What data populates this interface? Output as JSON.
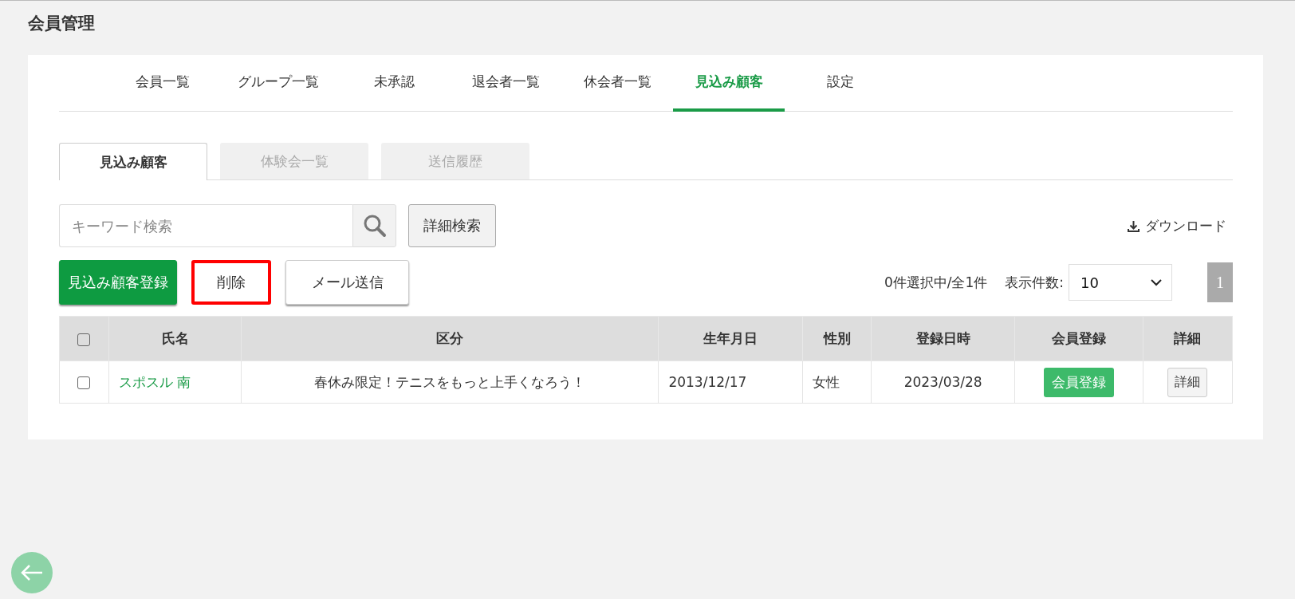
{
  "page_title": "会員管理",
  "tabs": [
    {
      "label": "会員一覧",
      "selected": false
    },
    {
      "label": "グループ一覧",
      "selected": false
    },
    {
      "label": "未承認",
      "selected": false
    },
    {
      "label": "退会者一覧",
      "selected": false
    },
    {
      "label": "休会者一覧",
      "selected": false
    },
    {
      "label": "見込み顧客",
      "selected": true
    },
    {
      "label": "設定",
      "selected": false
    }
  ],
  "sub_tabs": [
    {
      "label": "見込み顧客",
      "selected": true
    },
    {
      "label": "体験会一覧",
      "selected": false
    },
    {
      "label": "送信履歴",
      "selected": false
    }
  ],
  "search": {
    "placeholder": "キーワード検索",
    "advanced_button": "詳細検索"
  },
  "download": "ダウンロード",
  "actions": [
    {
      "label": "見込み顧客登録",
      "kind": "primary",
      "highlighted": false
    },
    {
      "label": "削除",
      "kind": "plain",
      "highlighted": true
    },
    {
      "label": "メール送信",
      "kind": "raised",
      "highlighted": false
    }
  ],
  "selection_count": "0件選択中/全1件",
  "page_size": {
    "label": "表示件数:",
    "value": "10"
  },
  "pages": [
    {
      "label": "1",
      "selected": true
    }
  ],
  "table": {
    "all_checked": false,
    "columns": [
      "氏名",
      "区分",
      "生年月日",
      "性別",
      "登録日時",
      "会員登録",
      "詳細"
    ],
    "rows": [
      {
        "checked": false,
        "name": "スポスル 南",
        "category": "春休み限定！テニスをもっと上手くなろう！",
        "birth_date": "2013/12/17",
        "gender": "女性",
        "registered_at": "2023/03/28",
        "register_button": "会員登録",
        "detail_button": "詳細"
      }
    ]
  }
}
